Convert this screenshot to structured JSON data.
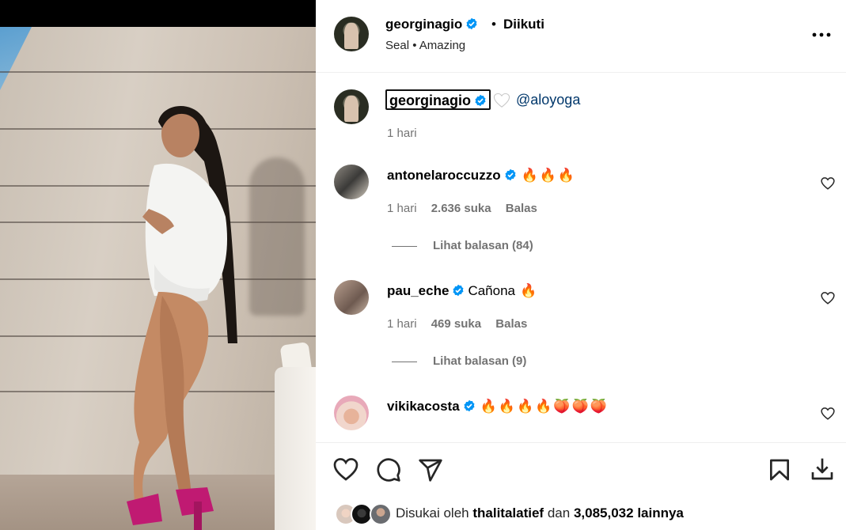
{
  "post": {
    "author": "georginagio",
    "follow_status": "Diikuti",
    "separator": "•",
    "audio": "Seal • Amazing"
  },
  "caption": {
    "user": "georginagio",
    "mention": "@aloyoga",
    "time": "1 hari"
  },
  "comments": [
    {
      "user": "antonelaroccuzzo",
      "text": "",
      "emojis": "🔥🔥🔥",
      "time": "1 hari",
      "likes": "2.636 suka",
      "reply": "Balas",
      "view_replies": "Lihat balasan (84)"
    },
    {
      "user": "pau_eche",
      "text": "Cañona",
      "emojis": "🔥",
      "time": "1 hari",
      "likes": "469 suka",
      "reply": "Balas",
      "view_replies": "Lihat balasan (9)"
    },
    {
      "user": "vikikacosta",
      "text": "",
      "emojis": "🔥🔥🔥🔥🍑🍑🍑"
    }
  ],
  "liked_by": {
    "prefix": "Disukai oleh",
    "user": "thalitalatief",
    "conj": "dan",
    "count": "3,085,032",
    "suffix": "lainnya"
  },
  "icons": {
    "verified": "verified-badge-icon",
    "more": "more-options-icon",
    "like": "heart-icon",
    "comment": "comment-icon",
    "share": "share-icon",
    "save": "bookmark-icon",
    "download": "download-icon"
  },
  "colors": {
    "verified": "#0095f6",
    "link": "#00376b",
    "secondary_text": "#737373"
  }
}
